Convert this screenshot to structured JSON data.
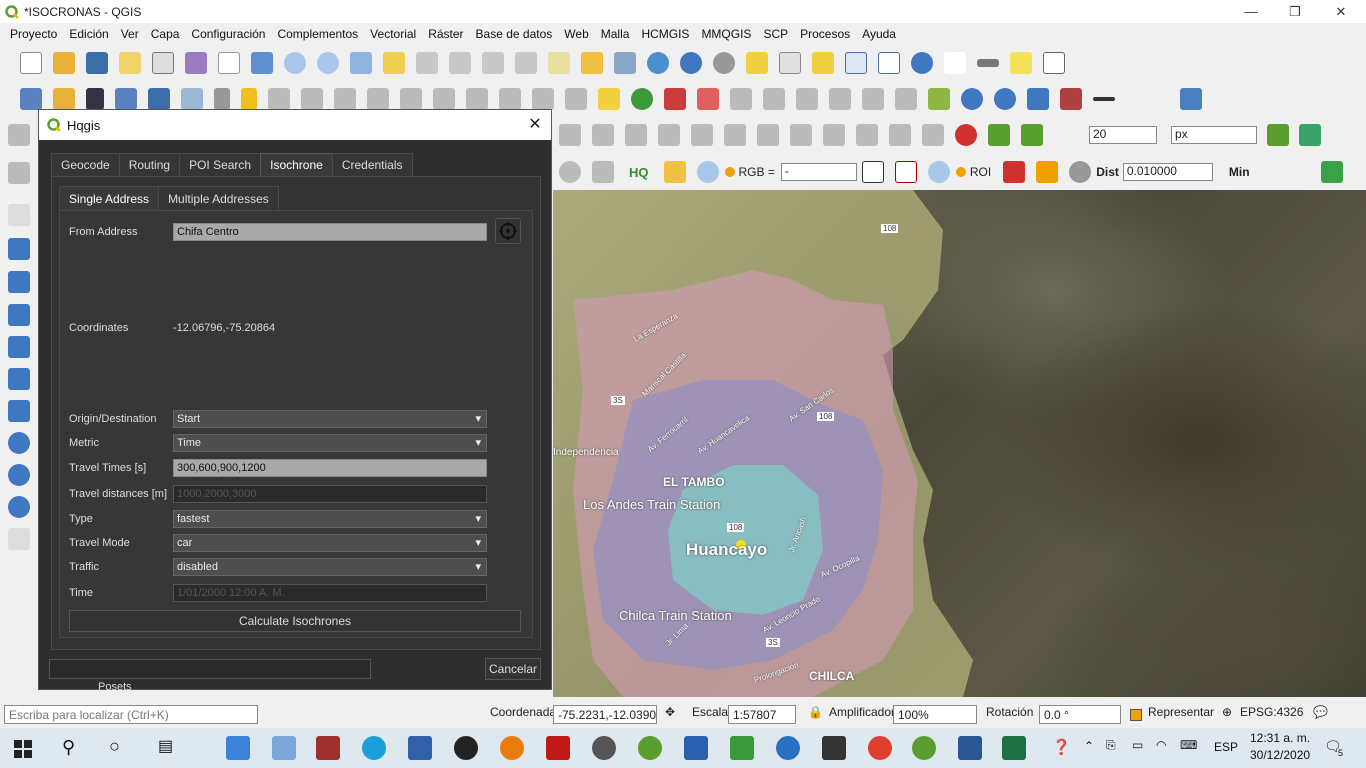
{
  "window": {
    "title": "*ISOCRONAS - QGIS"
  },
  "menu": [
    "Proyecto",
    "Edición",
    "Ver",
    "Capa",
    "Configuración",
    "Complementos",
    "Vectorial",
    "Ráster",
    "Base de datos",
    "Web",
    "Malla",
    "HCMGIS",
    "MMQGIS",
    "SCP",
    "Procesos",
    "Ayuda"
  ],
  "toolbar_right": {
    "size_value": "20",
    "size_unit": "px",
    "rgb_label": "RGB =",
    "rgb_value": "-",
    "roi_label": "ROI",
    "dist_label": "Dist",
    "dist_value": "0.010000",
    "min_label": "Min",
    "hq_label": "HQ"
  },
  "dialog": {
    "title": "Hqgis",
    "tabs": [
      "Geocode",
      "Routing",
      "POI Search",
      "Isochrone",
      "Credentials"
    ],
    "subtabs": [
      "Single Address",
      "Multiple Addresses"
    ],
    "from_address_label": "From Address",
    "from_address_value": "Chifa Centro",
    "coordinates_label": "Coordinates",
    "coordinates_value": "-12.06796,-75.20864",
    "origin_label": "Origin/Destination",
    "origin_value": "Start",
    "metric_label": "Metric",
    "metric_value": "Time",
    "travel_times_label": "Travel Times [s]",
    "travel_times_value": "300,600,900,1200",
    "travel_distances_label": "Travel distances [m]",
    "travel_distances_value": "1000,2000,3000",
    "type_label": "Type",
    "type_value": "fastest",
    "travel_mode_label": "Travel Mode",
    "travel_mode_value": "car",
    "traffic_label": "Traffic",
    "traffic_value": "disabled",
    "time_label": "Time",
    "time_value": "1/01/2000 12:00 A. M.",
    "calculate_button": "Calculate Isochrones",
    "cancel_button": "Cancelar"
  },
  "map": {
    "labels": {
      "el_tambo": "EL TAMBO",
      "los_andes": "Los Andes Train Station",
      "huancayo": "Huancayo",
      "chilca_station": "Chilca Train Station",
      "chilca": "CHILCA",
      "independencia": "Independencia",
      "route_108a": "108",
      "route_108b": "108",
      "route_108c": "108",
      "route_3s": "3S",
      "route_3s_b": "3S",
      "la_esperanza": "La Esperanza",
      "mariscal_castilla": "Mariscal Castilla",
      "av_ferrocarril": "Av. Ferrocarril",
      "av_huancavelica": "Av. Huancavelica",
      "av_san_carlos": "Av. San Carlos",
      "jr_ancash": "Jr. Ancash",
      "av_ocopilla": "Av. Ocopilla",
      "av_leoncio_prado": "Av. Leoncio Prado",
      "jr_lima": "Jr. Lima",
      "prolongacion": "Prolongación"
    },
    "colors": {
      "isochrone_1": "#7fd0c4",
      "isochrone_2": "#8f8fc8",
      "isochrone_3": "#d49ab8",
      "isochrone_4": "#c9c98a"
    }
  },
  "statusbar": {
    "locate_placeholder": "Escriba para localizar (Ctrl+K)",
    "coord_label": "Coordenada",
    "coord_value": "-75.2231,-12.0390",
    "scale_label": "Escala",
    "scale_value": "1:57807",
    "magnifier_label": "Amplificador",
    "magnifier_value": "100%",
    "rotation_label": "Rotación",
    "rotation_value": "0.0 °",
    "render_label": "Representar",
    "crs_value": "EPSG:4326",
    "layer_partial": "Posets"
  },
  "taskbar": {
    "lang": "ESP",
    "time": "12:31 a. m.",
    "date": "30/12/2020",
    "notif_count": "5"
  }
}
